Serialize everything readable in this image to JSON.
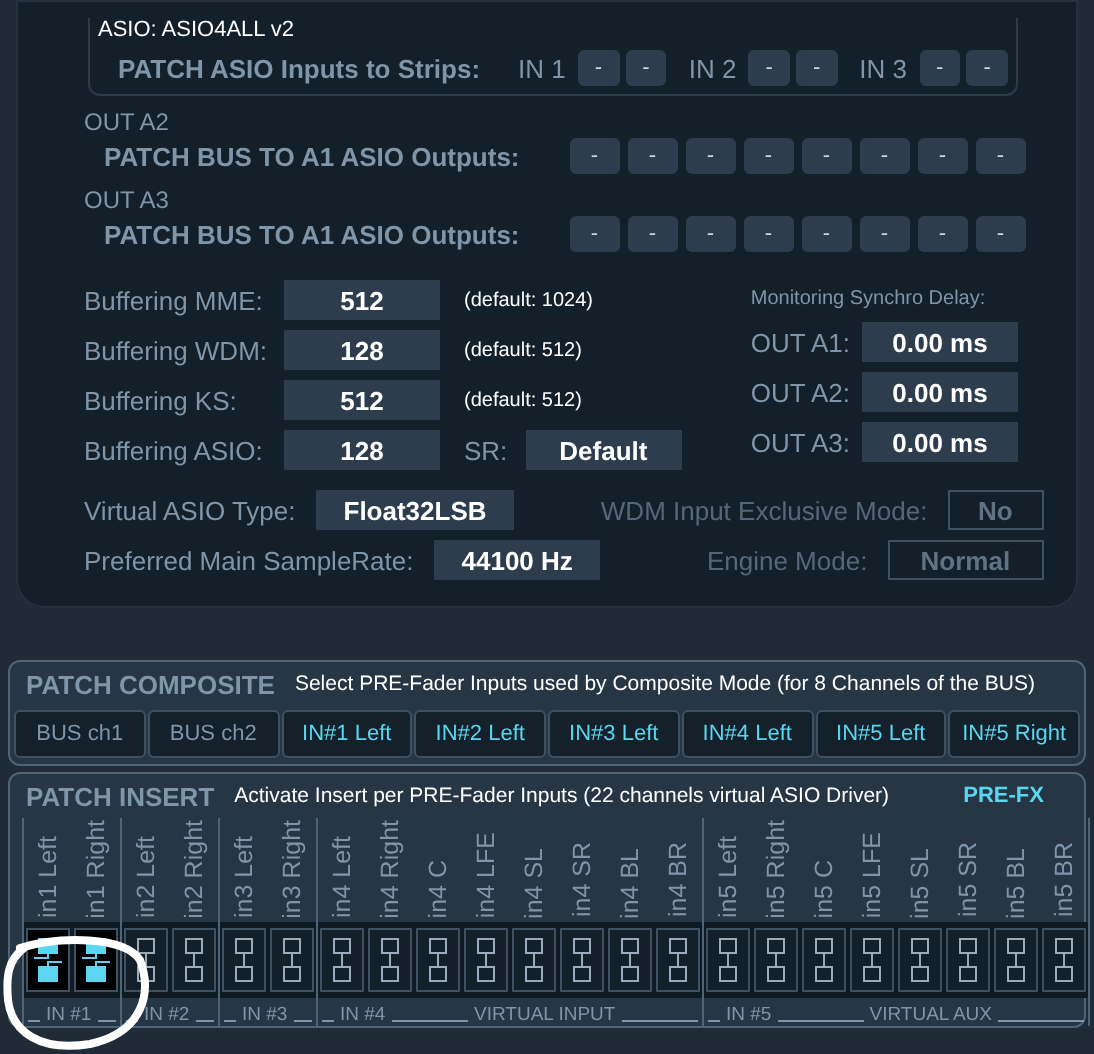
{
  "asio_device": "ASIO: ASIO4ALL v2",
  "patch_inputs": {
    "label": "PATCH ASIO Inputs to Strips:",
    "inputs": [
      {
        "label": "IN 1",
        "slots": [
          "-",
          "-"
        ]
      },
      {
        "label": "IN 2",
        "slots": [
          "-",
          "-"
        ]
      },
      {
        "label": "IN 3",
        "slots": [
          "-",
          "-"
        ]
      }
    ]
  },
  "out_patches": [
    {
      "title": "OUT A2",
      "label": "PATCH BUS TO A1 ASIO Outputs:",
      "slots": [
        "-",
        "-",
        "-",
        "-",
        "-",
        "-",
        "-",
        "-"
      ]
    },
    {
      "title": "OUT A3",
      "label": "PATCH BUS TO A1 ASIO Outputs:",
      "slots": [
        "-",
        "-",
        "-",
        "-",
        "-",
        "-",
        "-",
        "-"
      ]
    }
  ],
  "buffering": [
    {
      "label": "Buffering MME:",
      "value": "512",
      "note": "(default: 1024)"
    },
    {
      "label": "Buffering WDM:",
      "value": "128",
      "note": "(default: 512)"
    },
    {
      "label": "Buffering KS:",
      "value": "512",
      "note": "(default: 512)"
    },
    {
      "label": "Buffering ASIO:",
      "value": "128",
      "sr": {
        "label": "SR:",
        "value": "Default"
      }
    }
  ],
  "sync_delay": {
    "title": "Monitoring Synchro Delay:",
    "rows": [
      {
        "label": "OUT A1:",
        "value": "0.00 ms"
      },
      {
        "label": "OUT A2:",
        "value": "0.00 ms"
      },
      {
        "label": "OUT A3:",
        "value": "0.00 ms"
      }
    ]
  },
  "options": [
    {
      "label": "Virtual ASIO Type:",
      "value": "Float32LSB",
      "disabled": false
    },
    {
      "label": "WDM Input Exclusive Mode:",
      "value": "No",
      "disabled": true
    },
    {
      "label": "Preferred Main SampleRate:",
      "value": "44100 Hz",
      "disabled": false
    },
    {
      "label": "Engine Mode:",
      "value": "Normal",
      "disabled": true
    }
  ],
  "composite": {
    "title": "PATCH COMPOSITE",
    "description": "Select PRE-Fader Inputs used by Composite Mode (for 8 Channels of the BUS)",
    "buttons": [
      {
        "label": "BUS ch1",
        "kind": "bus"
      },
      {
        "label": "BUS ch2",
        "kind": "bus"
      },
      {
        "label": "IN#1 Left",
        "kind": "input"
      },
      {
        "label": "IN#2 Left",
        "kind": "input"
      },
      {
        "label": "IN#3 Left",
        "kind": "input"
      },
      {
        "label": "IN#4 Left",
        "kind": "input"
      },
      {
        "label": "IN#5 Left",
        "kind": "input"
      },
      {
        "label": "IN#5 Right",
        "kind": "input"
      }
    ]
  },
  "insert": {
    "title": "PATCH INSERT",
    "description": "Activate Insert per PRE-Fader Inputs (22 channels virtual ASIO Driver)",
    "badge": "PRE-FX",
    "groups": [
      {
        "labels": [
          "IN #1"
        ],
        "channels": [
          {
            "label": "in1 Left",
            "on": true
          },
          {
            "label": "in1 Right",
            "on": true
          }
        ]
      },
      {
        "labels": [
          "IN #2"
        ],
        "channels": [
          {
            "label": "in2 Left",
            "on": false
          },
          {
            "label": "in2 Right",
            "on": false
          }
        ]
      },
      {
        "labels": [
          "IN #3"
        ],
        "channels": [
          {
            "label": "in3 Left",
            "on": false
          },
          {
            "label": "in3 Right",
            "on": false
          }
        ]
      },
      {
        "labels": [
          "IN #4",
          "VIRTUAL INPUT"
        ],
        "channels": [
          {
            "label": "in4 Left",
            "on": false
          },
          {
            "label": "in4 Right",
            "on": false
          },
          {
            "label": "in4 C",
            "on": false
          },
          {
            "label": "in4 LFE",
            "on": false
          },
          {
            "label": "in4 SL",
            "on": false
          },
          {
            "label": "in4 SR",
            "on": false
          },
          {
            "label": "in4 BL",
            "on": false
          },
          {
            "label": "in4 BR",
            "on": false
          }
        ]
      },
      {
        "labels": [
          "IN #5",
          "VIRTUAL AUX"
        ],
        "channels": [
          {
            "label": "in5 Left",
            "on": false
          },
          {
            "label": "in5 Right",
            "on": false
          },
          {
            "label": "in5 C",
            "on": false
          },
          {
            "label": "in5 LFE",
            "on": false
          },
          {
            "label": "in5 SL",
            "on": false
          },
          {
            "label": "in5 SR",
            "on": false
          },
          {
            "label": "in5 BL",
            "on": false
          },
          {
            "label": "in5 BR",
            "on": false
          }
        ]
      }
    ]
  }
}
